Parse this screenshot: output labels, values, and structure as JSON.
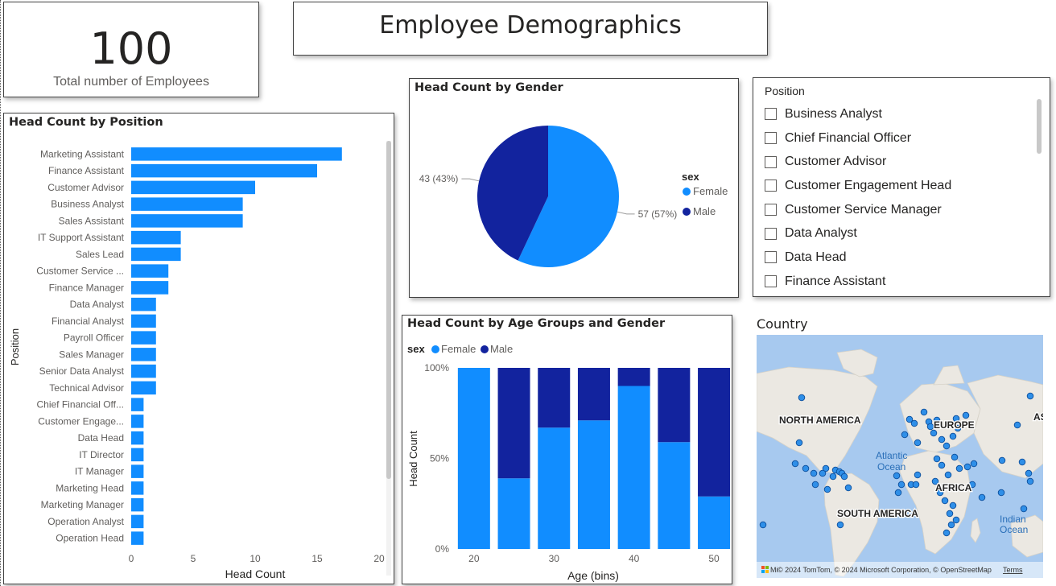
{
  "kpi": {
    "value": "100",
    "label": "Total number of Employees"
  },
  "dashboard_title": "Employee Demographics",
  "colors": {
    "female": "#118DFF",
    "male": "#12239E",
    "water": "#a7c9ef",
    "land": "#ebe8e2"
  },
  "chart_data": [
    {
      "type": "bar",
      "orientation": "horizontal",
      "title": "Head Count by Position",
      "xlabel": "Head Count",
      "ylabel": "Position",
      "xlim": [
        0,
        20
      ],
      "xticks": [
        "0",
        "5",
        "10",
        "15",
        "20"
      ],
      "categories": [
        "Marketing Assistant",
        "Finance Assistant",
        "Customer Advisor",
        "Business Analyst",
        "Sales Assistant",
        "IT Support Assistant",
        "Sales Lead",
        "Customer Service ...",
        "Finance Manager",
        "Data Analyst",
        "Financial Analyst",
        "Payroll Officer",
        "Sales Manager",
        "Senior Data Analyst",
        "Technical Advisor",
        "Chief Financial Off...",
        "Customer Engage...",
        "Data Head",
        "IT Director",
        "IT Manager",
        "Marketing Head",
        "Marketing Manager",
        "Operation Analyst",
        "Operation Head"
      ],
      "values": [
        17,
        15,
        10,
        9,
        9,
        4,
        4,
        3,
        3,
        2,
        2,
        2,
        2,
        2,
        2,
        1,
        1,
        1,
        1,
        1,
        1,
        1,
        1,
        1
      ],
      "grid": false
    },
    {
      "type": "pie",
      "title": "Head Count by Gender",
      "legend_title": "sex",
      "legend_position": "right",
      "slices": [
        {
          "name": "Female",
          "value": 57,
          "label": "57 (57%)"
        },
        {
          "name": "Male",
          "value": 43,
          "label": "43 (43%)"
        }
      ]
    },
    {
      "type": "bar",
      "stacked": "percent",
      "title": "Head Count by Age Groups and Gender",
      "xlabel": "Age (bins)",
      "ylabel": "Head Count",
      "legend_title": "sex",
      "legend_position": "top-left",
      "x": [
        20,
        25,
        30,
        35,
        40,
        45,
        50
      ],
      "xticks": [
        "20",
        "30",
        "40",
        "50"
      ],
      "yticks": [
        "0%",
        "50%",
        "100%"
      ],
      "ylim": [
        0,
        100
      ],
      "series": [
        {
          "name": "Female",
          "values": [
            100,
            39,
            67,
            71,
            90,
            59,
            29
          ]
        },
        {
          "name": "Male",
          "values": [
            0,
            61,
            33,
            29,
            10,
            41,
            71
          ]
        }
      ]
    }
  ],
  "slicer": {
    "title": "Position",
    "items": [
      "Business Analyst",
      "Chief Financial Officer",
      "Customer Advisor",
      "Customer Engagement Head",
      "Customer Service Manager",
      "Data Analyst",
      "Data Head",
      "Finance Assistant"
    ]
  },
  "map": {
    "title": "Country",
    "labels": [
      "NORTH AMERICA",
      "EUROPE",
      "AS",
      "Atlantic",
      "Ocean",
      "AFRICA",
      "SOUTH AMERICA",
      "Indian",
      "Ocean"
    ],
    "attribution": "© 2024 TomTom, © 2024 Microsoft Corporation, © OpenStreetMap",
    "terms": "Terms",
    "logo_text": "Mi"
  }
}
